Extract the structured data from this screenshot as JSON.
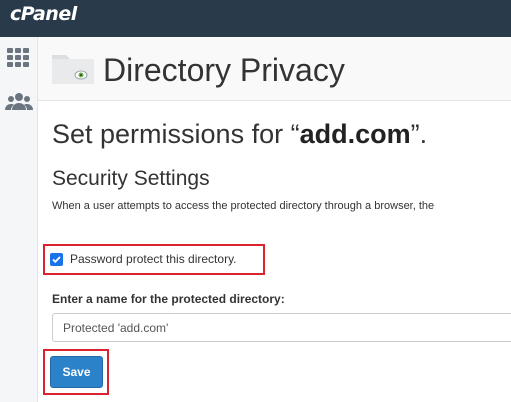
{
  "app": {
    "logo_text": "cPanel"
  },
  "sidebar": {
    "items": [
      {
        "icon": "grid-icon"
      },
      {
        "icon": "users-icon"
      }
    ]
  },
  "header": {
    "title": "Directory Privacy",
    "icon": "folder-eye-icon"
  },
  "main": {
    "permissions_prefix": "Set permissions for “",
    "domain": "add.com",
    "permissions_suffix": "”.",
    "security_heading": "Security Settings",
    "security_description": "When a user attempts to access the protected directory through a browser, the",
    "protect_checkbox": {
      "label": "Password protect this directory.",
      "checked": true
    },
    "name_field": {
      "label": "Enter a name for the protected directory:",
      "value": "Protected 'add.com'"
    },
    "save_label": "Save"
  },
  "colors": {
    "topbar": "#293a4a",
    "primary_button": "#2c82c9",
    "highlight": "#d9232e",
    "checkbox": "#1a73e8"
  }
}
